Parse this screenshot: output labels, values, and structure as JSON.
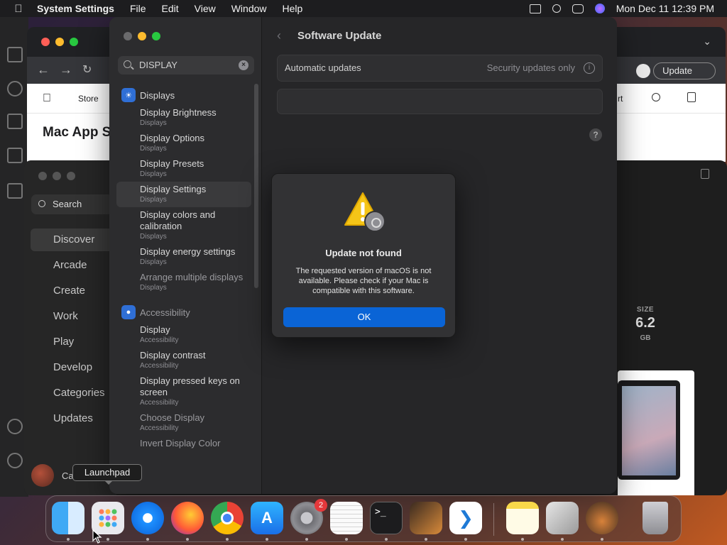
{
  "menubar": {
    "app_name": "System Settings",
    "menus": [
      "File",
      "Edit",
      "View",
      "Window",
      "Help"
    ],
    "clock": "Mon Dec 11  12:39 PM"
  },
  "browser": {
    "nav_store": "Store",
    "nav_support_partial": "rt",
    "page_heading_partial": "Mac App S",
    "update_button": "Update"
  },
  "app_store": {
    "search_placeholder": "Search",
    "nav": [
      "Discover",
      "Arcade",
      "Create",
      "Work",
      "Play",
      "Develop",
      "Categories",
      "Updates"
    ],
    "user_partial": "Ca",
    "size_label": "SIZE",
    "size_value": "6.2",
    "size_unit": "GB"
  },
  "settings": {
    "search_value": "DISPLAY",
    "page_title": "Software Update",
    "automatic_updates_label": "Automatic updates",
    "automatic_updates_value": "Security updates only",
    "sections": [
      {
        "header": "Displays",
        "items": [
          {
            "title": "Display Brightness",
            "sub": "Displays"
          },
          {
            "title": "Display Options",
            "sub": "Displays"
          },
          {
            "title": "Display Presets",
            "sub": "Displays"
          },
          {
            "title": "Display Settings",
            "sub": "Displays"
          },
          {
            "title": "Display colors and calibration",
            "sub": "Displays"
          },
          {
            "title": "Display energy settings",
            "sub": "Displays"
          },
          {
            "title": "Arrange multiple displays",
            "sub": "Displays"
          }
        ]
      },
      {
        "header": "Accessibility",
        "items": [
          {
            "title": "Display",
            "sub": "Accessibility"
          },
          {
            "title": "Display contrast",
            "sub": "Accessibility"
          },
          {
            "title": "Display pressed keys on screen",
            "sub": "Accessibility"
          },
          {
            "title": "Choose Display",
            "sub": "Accessibility"
          },
          {
            "title": "Invert Display Color",
            "sub": ""
          }
        ]
      }
    ]
  },
  "alert": {
    "title": "Update not found",
    "message": "The requested version of macOS is not available. Please check if your Mac is compatible with this software.",
    "ok_label": "OK"
  },
  "tooltip": "Launchpad",
  "dock": {
    "settings_badge": "2",
    "apps": [
      "finder",
      "launchpad",
      "safari",
      "firefox",
      "chrome",
      "app-store",
      "system-settings",
      "textedit",
      "terminal",
      "garageband",
      "vscode",
      "notes",
      "disk-utility",
      "installer",
      "trash"
    ]
  },
  "colors": {
    "accent": "#0a64d6",
    "badge": "#e5383b",
    "warning": "#f5c518"
  }
}
